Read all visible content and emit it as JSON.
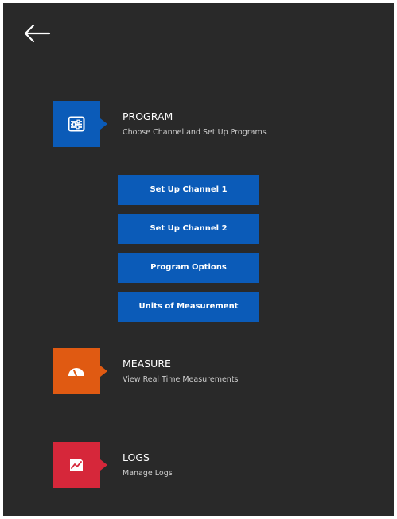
{
  "colors": {
    "background": "#292929",
    "program": "#0b5bb8",
    "measure": "#e05a12",
    "logs": "#d6273a",
    "text_primary": "#ffffff",
    "text_secondary": "#cfcfcf"
  },
  "header": {
    "back_icon": "back-arrow-icon"
  },
  "program": {
    "icon": "sliders-panel-icon",
    "title": "PROGRAM",
    "subtitle": "Choose Channel and Set Up Programs",
    "buttons": [
      {
        "label": "Set Up Channel 1"
      },
      {
        "label": "Set Up Channel 2"
      },
      {
        "label": "Program Options"
      },
      {
        "label": "Units of Measurement"
      }
    ]
  },
  "measure": {
    "icon": "gauge-icon",
    "title": "MEASURE",
    "subtitle": "View Real Time Measurements"
  },
  "logs": {
    "icon": "chart-log-icon",
    "title": "LOGS",
    "subtitle": "Manage Logs"
  }
}
